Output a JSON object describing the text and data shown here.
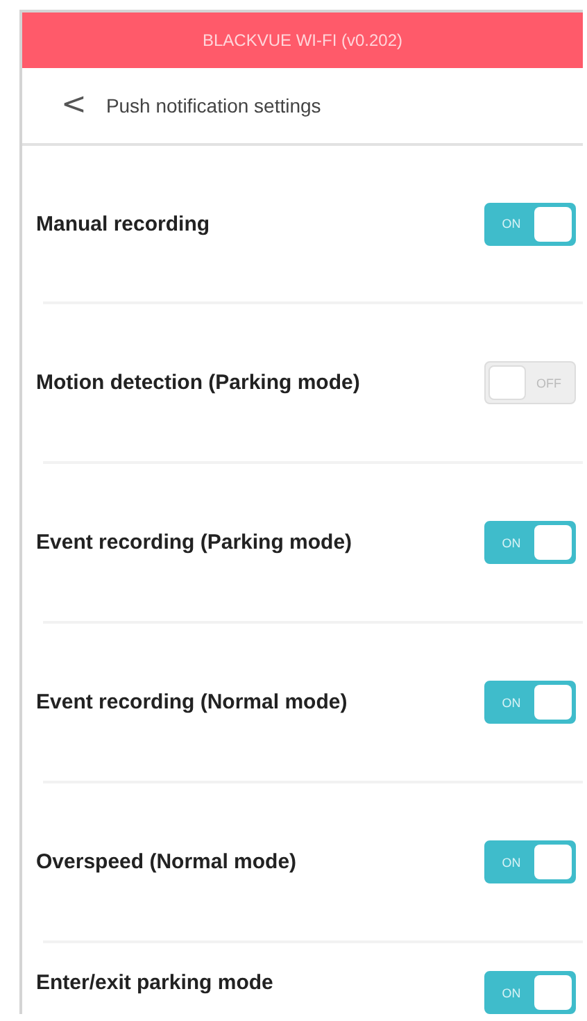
{
  "header": {
    "title": "BLACKVUE WI-FI (v0.202)"
  },
  "nav": {
    "back": "<",
    "title": "Push notification settings"
  },
  "settings": [
    {
      "label": "Manual recording",
      "on": true,
      "switch_text": "ON"
    },
    {
      "label": "Motion detection (Parking mode)",
      "on": false,
      "switch_text": "OFF"
    },
    {
      "label": "Event recording (Parking mode)",
      "on": true,
      "switch_text": "ON"
    },
    {
      "label": "Event recording (Normal mode)",
      "on": true,
      "switch_text": "ON"
    },
    {
      "label": "Overspeed (Normal mode)",
      "on": true,
      "switch_text": "ON"
    },
    {
      "label": "Enter/exit parking mode",
      "on": true,
      "switch_text": "ON"
    }
  ]
}
